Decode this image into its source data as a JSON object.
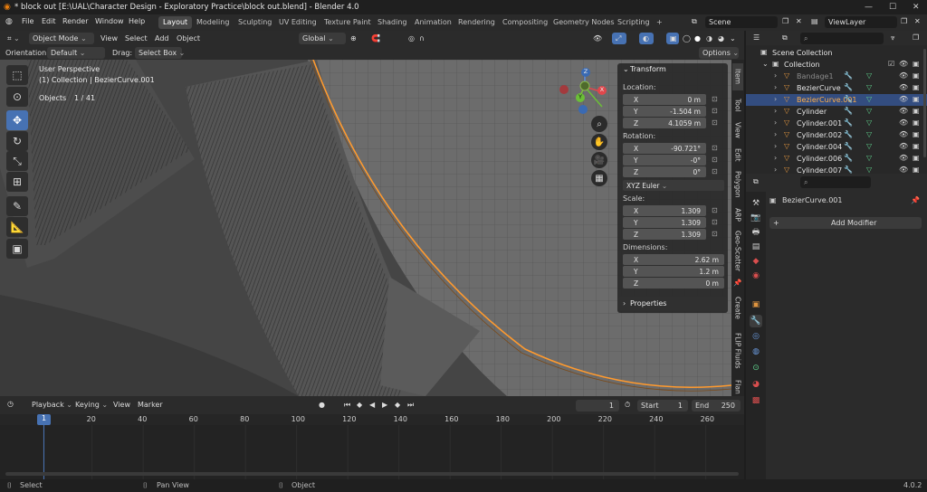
{
  "window": {
    "title": "* block out [E:\\UAL\\Character Design - Exploratory Practice\\block out.blend] - Blender 4.0",
    "controls": [
      "—",
      "☐",
      "✕"
    ]
  },
  "menu": {
    "items": [
      "File",
      "Edit",
      "Render",
      "Window",
      "Help"
    ],
    "workspaces": [
      "Layout",
      "Modeling",
      "Sculpting",
      "UV Editing",
      "Texture Paint",
      "Shading",
      "Animation",
      "Rendering",
      "Compositing",
      "Geometry Nodes",
      "Scripting"
    ],
    "active_workspace": "Layout",
    "add_workspace": "+",
    "scene": "Scene",
    "view_layer": "ViewLayer"
  },
  "viewport_header": {
    "mode": "Object Mode",
    "menus": [
      "View",
      "Select",
      "Add",
      "Object"
    ],
    "transform_orientation": "Global"
  },
  "tool_header": {
    "orientation_label": "Orientation:",
    "orientation_value": "Default",
    "drag_label": "Drag:",
    "drag_value": "Select Box",
    "options": "Options"
  },
  "viewport": {
    "view_name": "User Perspective",
    "collection_info": "(1) Collection | BezierCurve.001",
    "objects_label": "Objects",
    "objects_count": "1 / 41",
    "gizmo": {
      "x": "X",
      "y": "Y",
      "z": "Z"
    }
  },
  "npanel": {
    "transform_title": "Transform",
    "location_label": "Location:",
    "location": [
      {
        "axis": "X",
        "value": "0 m"
      },
      {
        "axis": "Y",
        "value": "-1.504 m"
      },
      {
        "axis": "Z",
        "value": "4.1059 m"
      }
    ],
    "rotation_label": "Rotation:",
    "rotation": [
      {
        "axis": "X",
        "value": "-90.721°"
      },
      {
        "axis": "Y",
        "value": "-0°"
      },
      {
        "axis": "Z",
        "value": "0°"
      }
    ],
    "rotation_mode": "XYZ Euler",
    "scale_label": "Scale:",
    "scale": [
      {
        "axis": "X",
        "value": "1.309"
      },
      {
        "axis": "Y",
        "value": "1.309"
      },
      {
        "axis": "Z",
        "value": "1.309"
      }
    ],
    "dimensions_label": "Dimensions:",
    "dimensions": [
      {
        "axis": "X",
        "value": "2.62 m"
      },
      {
        "axis": "Y",
        "value": "1.2 m"
      },
      {
        "axis": "Z",
        "value": "0 m"
      }
    ],
    "properties_title": "Properties"
  },
  "sidebar_tabs": [
    "Item",
    "Tool",
    "View",
    "Edit",
    "Polygon",
    "ARP",
    "Geo-Scatter",
    "Create",
    "FLIP Fluids",
    "Flan"
  ],
  "timeline": {
    "menus": [
      "Playback",
      "Keying",
      "View",
      "Marker"
    ],
    "current_frame": "1",
    "start_label": "Start",
    "start": "1",
    "end_label": "End",
    "end": "250",
    "ticks": [
      "1",
      "20",
      "40",
      "60",
      "80",
      "100",
      "120",
      "140",
      "160",
      "180",
      "200",
      "220",
      "240",
      "260"
    ]
  },
  "statusbar": {
    "select": "Select",
    "pan_view": "Pan View",
    "object": "Object",
    "version": "4.0.2"
  },
  "outliner": {
    "scene_collection": "Scene Collection",
    "collection": "Collection",
    "items": [
      {
        "name": "Bandage1",
        "color": "#8a8a8a",
        "icon_color": "#e0953f"
      },
      {
        "name": "BezierCurve",
        "color": "#e6e6e6",
        "icon_color": "#e0953f"
      },
      {
        "name": "BezierCurve.001",
        "color": "#ffae4a",
        "icon_color": "#e0953f"
      },
      {
        "name": "Cylinder",
        "color": "#e6e6e6",
        "icon_color": "#e0953f"
      },
      {
        "name": "Cylinder.001",
        "color": "#e6e6e6",
        "icon_color": "#e0953f"
      },
      {
        "name": "Cylinder.002",
        "color": "#e6e6e6",
        "icon_color": "#e0953f"
      },
      {
        "name": "Cylinder.004",
        "color": "#e6e6e6",
        "icon_color": "#e0953f"
      },
      {
        "name": "Cylinder.006",
        "color": "#e6e6e6",
        "icon_color": "#e0953f"
      },
      {
        "name": "Cylinder.007",
        "color": "#e6e6e6",
        "icon_color": "#e0953f"
      }
    ]
  },
  "properties": {
    "object_name": "BezierCurve.001",
    "add_modifier": "Add Modifier"
  },
  "colors": {
    "accent": "#4772b3",
    "selected_outline": "#ff9a2e",
    "grid_bg": "#404040"
  }
}
